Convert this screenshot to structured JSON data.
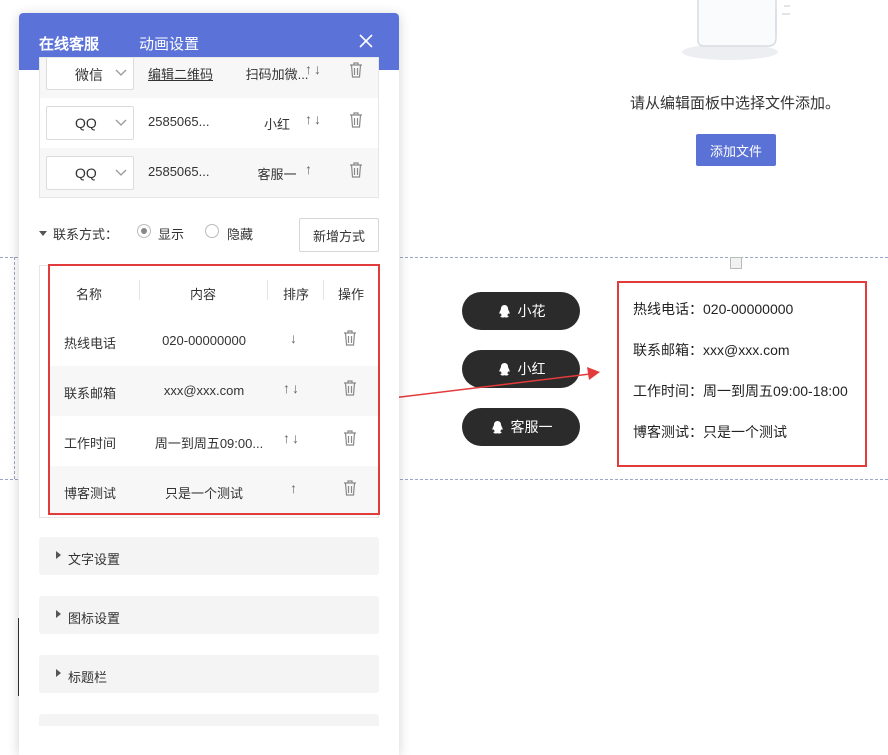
{
  "panel": {
    "tabs": [
      {
        "label": "在线客服"
      },
      {
        "label": "动画设置"
      }
    ],
    "top_rows": [
      {
        "type": "微信",
        "value": "编辑二维码",
        "name": "扫码加微...",
        "arrows": "↑↓"
      },
      {
        "type": "QQ",
        "value": "2585065...",
        "name": "小红",
        "arrows": "↑↓"
      },
      {
        "type": "QQ",
        "value": "2585065...",
        "name": "客服一",
        "arrows": "↑"
      }
    ],
    "contact": {
      "label": "联系方式：",
      "show_label": "显示",
      "hide_label": "隐藏",
      "selected": "显示",
      "add_button": "新增方式"
    },
    "table": {
      "headers": {
        "name": "名称",
        "content": "内容",
        "order": "排序",
        "action": "操作"
      },
      "rows": [
        {
          "name": "热线电话",
          "content": "020-00000000",
          "order": "↓"
        },
        {
          "name": "联系邮箱",
          "content": "xxx@xxx.com",
          "order": "↑↓"
        },
        {
          "name": "工作时间",
          "content": "周一到周五09:00...",
          "order": "↑↓"
        },
        {
          "name": "博客测试",
          "content": "只是一个测试",
          "order": "↑"
        }
      ]
    },
    "sections": [
      {
        "label": "文字设置"
      },
      {
        "label": "图标设置"
      },
      {
        "label": "标题栏"
      }
    ]
  },
  "canvas": {
    "empty_text": "请从编辑面板中选择文件添加。",
    "add_file_button": "添加文件",
    "pills": [
      {
        "label": "小花"
      },
      {
        "label": "小红"
      },
      {
        "label": "客服一"
      }
    ],
    "info_lines": [
      "热线电话：020-00000000",
      "联系邮箱：xxx@xxx.com",
      "工作时间：周一到周五09:00-18:00",
      "博客测试：只是一个测试"
    ]
  },
  "colors": {
    "accent": "#5b73d8",
    "highlight": "#e23b3b",
    "pill": "#2b2b2b"
  }
}
